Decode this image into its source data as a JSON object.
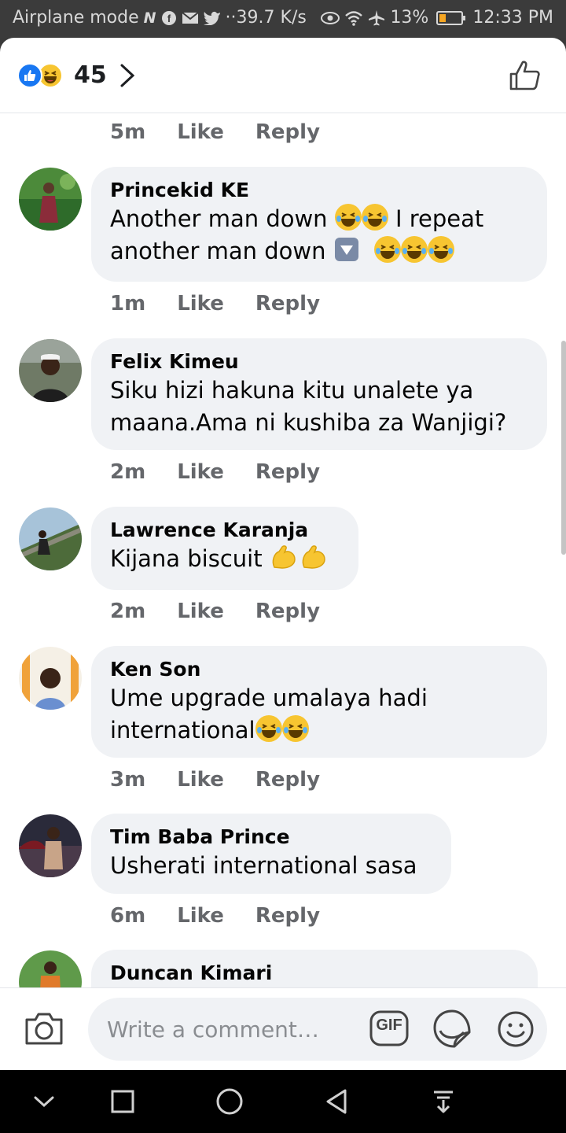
{
  "status_bar": {
    "mode": "Airplane mode",
    "net_speed": "··39.7 K/s",
    "battery": "13%",
    "time": "12:33 PM"
  },
  "header": {
    "reaction_count": "45"
  },
  "top_meta": {
    "time": "5m",
    "like": "Like",
    "reply": "Reply"
  },
  "comments": [
    {
      "author": "Princekid KE",
      "line1": "Another man down",
      "line1b": "I repeat",
      "line2": "another man down",
      "time": "1m",
      "like": "Like",
      "reply": "Reply"
    },
    {
      "author": "Felix Kimeu",
      "line1": "Siku hizi hakuna kitu unalete ya",
      "line2": "maana.Ama ni kushiba za Wanjigi?",
      "time": "2m",
      "like": "Like",
      "reply": "Reply"
    },
    {
      "author": "Lawrence Karanja",
      "line1": "Kijana biscuit",
      "time": "2m",
      "like": "Like",
      "reply": "Reply"
    },
    {
      "author": "Ken Son",
      "line1": "Ume upgrade umalaya hadi",
      "line2": "international",
      "time": "3m",
      "like": "Like",
      "reply": "Reply"
    },
    {
      "author": "Tim Baba Prince",
      "line1": "Usherati international sasa",
      "time": "6m",
      "like": "Like",
      "reply": "Reply"
    },
    {
      "author": "Duncan Kimari"
    }
  ],
  "input": {
    "placeholder": "Write a comment…",
    "gif_label": "GIF"
  },
  "icons": {
    "reaction_like": "like-reaction-icon",
    "reaction_haha": "haha-reaction-icon",
    "thumb": "thumbs-up-icon",
    "camera": "camera-icon",
    "sticker": "sticker-icon",
    "emoji": "emoji-icon"
  },
  "colors": {
    "facebook_blue": "#1877f2",
    "bubble_bg": "#f0f2f5",
    "meta_gray": "#65676b",
    "emoji_yellow": "#f7c531"
  }
}
